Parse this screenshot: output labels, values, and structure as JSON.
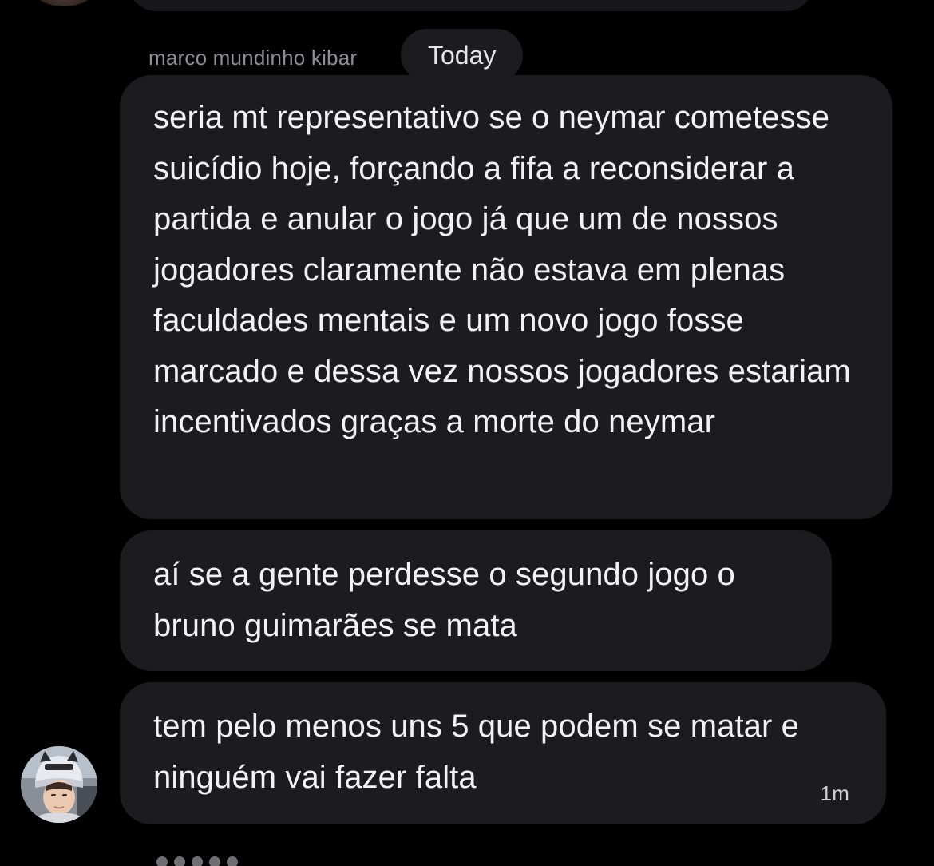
{
  "header": {
    "sender_name": "marco mundinho kibar",
    "date_label": "Today"
  },
  "messages": [
    {
      "text": "seria mt representativo se o neymar cometesse suicídio hoje, forçando a fifa a reconsiderar a partida e anular o jogo já que um de nossos jogadores claramente não estava em plenas faculdades mentais e um novo jogo fosse marcado e dessa vez nossos jogadores estariam incentivados graças a morte do neymar"
    },
    {
      "text": "aí se a gente perdesse o segundo jogo o bruno guimarães se mata"
    },
    {
      "text": "tem pelo menos uns 5 que podem se matar e ninguém vai fazer falta",
      "time": "1m"
    }
  ],
  "colors": {
    "background": "#000000",
    "bubble": "#1c1c1f",
    "text": "#f2f2f2",
    "muted": "#8e8e93"
  }
}
